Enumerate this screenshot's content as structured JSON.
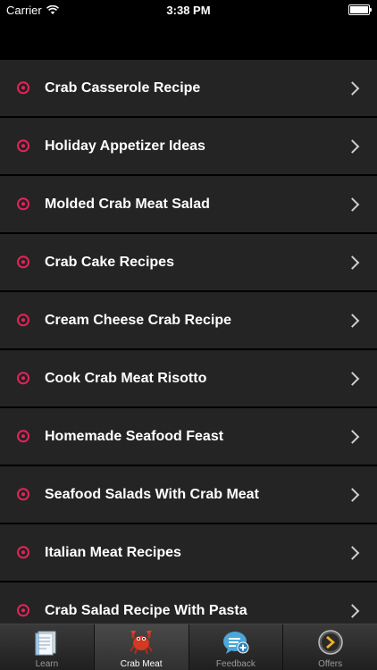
{
  "status": {
    "carrier": "Carrier",
    "time": "3:38 PM"
  },
  "list": {
    "items": [
      {
        "label": "Crab Casserole Recipe"
      },
      {
        "label": "Holiday Appetizer Ideas"
      },
      {
        "label": "Molded Crab Meat Salad"
      },
      {
        "label": "Crab Cake Recipes"
      },
      {
        "label": "Cream Cheese Crab Recipe"
      },
      {
        "label": "Cook Crab Meat Risotto"
      },
      {
        "label": "Homemade Seafood Feast"
      },
      {
        "label": "Seafood Salads With Crab Meat"
      },
      {
        "label": "Italian Meat Recipes"
      },
      {
        "label": "Crab Salad Recipe With Pasta"
      }
    ],
    "icon": "target-icon",
    "accent_color": "#e5235b"
  },
  "tabbar": {
    "tabs": [
      {
        "label": "Learn",
        "icon": "document-icon"
      },
      {
        "label": "Crab Meat",
        "icon": "crab-icon",
        "selected": true
      },
      {
        "label": "Feedback",
        "icon": "chat-bubble-icon"
      },
      {
        "label": "Offers",
        "icon": "chevron-circle-icon"
      }
    ]
  }
}
